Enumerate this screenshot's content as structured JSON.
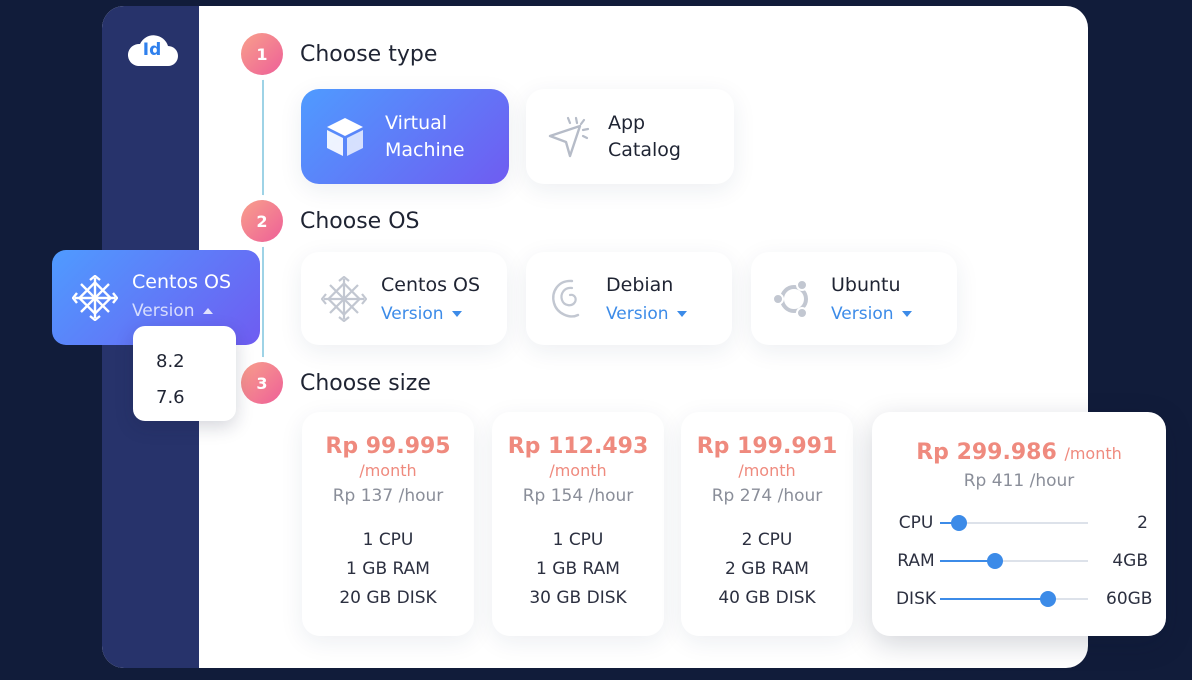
{
  "logo": {
    "text": "Id"
  },
  "steps": [
    {
      "number": "1",
      "title": "Choose type"
    },
    {
      "number": "2",
      "title": "Choose OS"
    },
    {
      "number": "3",
      "title": "Choose size"
    }
  ],
  "types": [
    {
      "line1": "Virtual",
      "line2": "Machine",
      "icon": "cube-icon",
      "selected": true
    },
    {
      "line1": "App",
      "line2": "Catalog",
      "icon": "cursor-click-icon",
      "selected": false
    }
  ],
  "os_options": [
    {
      "name": "Centos OS",
      "version_label": "Version",
      "icon": "centos-icon"
    },
    {
      "name": "Debian",
      "version_label": "Version",
      "icon": "debian-icon"
    },
    {
      "name": "Ubuntu",
      "version_label": "Version",
      "icon": "ubuntu-icon"
    }
  ],
  "selected_os": {
    "name": "Centos OS",
    "version_label": "Version",
    "versions": [
      "8.2",
      "7.6"
    ]
  },
  "sizes": [
    {
      "price": "Rp 99.995",
      "per_month": "/month",
      "per_hour": "Rp 137 /hour",
      "cpu": "1 CPU",
      "ram": "1 GB RAM",
      "disk": "20 GB DISK"
    },
    {
      "price": "Rp 112.493",
      "per_month": "/month",
      "per_hour": "Rp 154 /hour",
      "cpu": "1 CPU",
      "ram": "1 GB RAM",
      "disk": "30 GB DISK"
    },
    {
      "price": "Rp 199.991",
      "per_month": "/month",
      "per_hour": "Rp 274 /hour",
      "cpu": "2 CPU",
      "ram": "2 GB RAM",
      "disk": "40 GB DISK"
    }
  ],
  "custom_size": {
    "price": "Rp 299.986",
    "per_month": "/month",
    "per_hour": "Rp 411 /hour",
    "sliders": [
      {
        "label": "CPU",
        "value": "2",
        "fraction": 0.13
      },
      {
        "label": "RAM",
        "value": "4GB",
        "fraction": 0.37
      },
      {
        "label": "DISK",
        "value": "60GB",
        "fraction": 0.73
      }
    ]
  },
  "colors": {
    "background": "#111c3a",
    "sidebar": "#27336b",
    "accent_blue": "#3c8be8",
    "price_coral": "#ef8a7e",
    "step_gradient_start": "#f8a08b",
    "step_gradient_end": "#ee5f98",
    "selected_gradient_start": "#4f9bff",
    "selected_gradient_end": "#6f5cf1"
  }
}
